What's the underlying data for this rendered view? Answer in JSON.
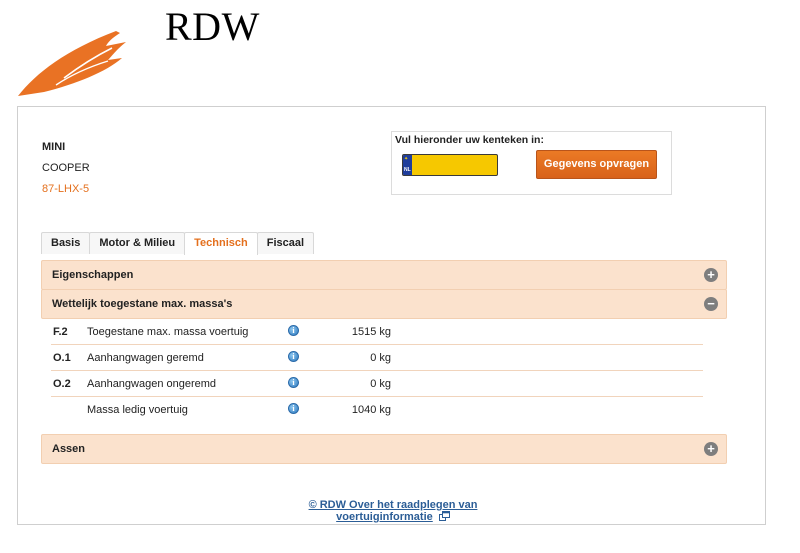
{
  "header": {
    "brand": "RDW",
    "logo_icon": "rdw-flame-logo-icon",
    "brand_color": "#e4701e"
  },
  "vehicle": {
    "make": "MINI",
    "model": "COOPER",
    "plate": "87-LHX-5"
  },
  "lookup": {
    "label": "Vul hieronder uw kenteken in:",
    "input_value": "",
    "plate_country": "NL",
    "button_label": "Gegevens opvragen"
  },
  "tabs": [
    {
      "label": "Basis",
      "active": false
    },
    {
      "label": "Motor & Milieu",
      "active": false
    },
    {
      "label": "Technisch",
      "active": true
    },
    {
      "label": "Fiscaal",
      "active": false
    }
  ],
  "sections": {
    "eigenschappen": {
      "title": "Eigenschappen",
      "toggle": "+",
      "icon": "plus-circle-icon"
    },
    "massa": {
      "title": "Wettelijk toegestane max. massa's",
      "toggle": "−",
      "icon": "minus-circle-icon"
    },
    "assen": {
      "title": "Assen",
      "toggle": "+",
      "icon": "plus-circle-icon"
    }
  },
  "massa_rows": [
    {
      "code": "F.2",
      "label": "Toegestane max. massa voertuig",
      "value": "1515 kg"
    },
    {
      "code": "O.1",
      "label": "Aanhangwagen geremd",
      "value": "0 kg"
    },
    {
      "code": "O.2",
      "label": "Aanhangwagen ongeremd",
      "value": "0 kg"
    },
    {
      "code": "",
      "label": "Massa ledig voertuig",
      "value": "1040 kg"
    }
  ],
  "info_icon_glyph": "i",
  "footer": {
    "link_text": "© RDW  Over het raadplegen van voertuiginformatie",
    "icon": "external-link-icon"
  }
}
